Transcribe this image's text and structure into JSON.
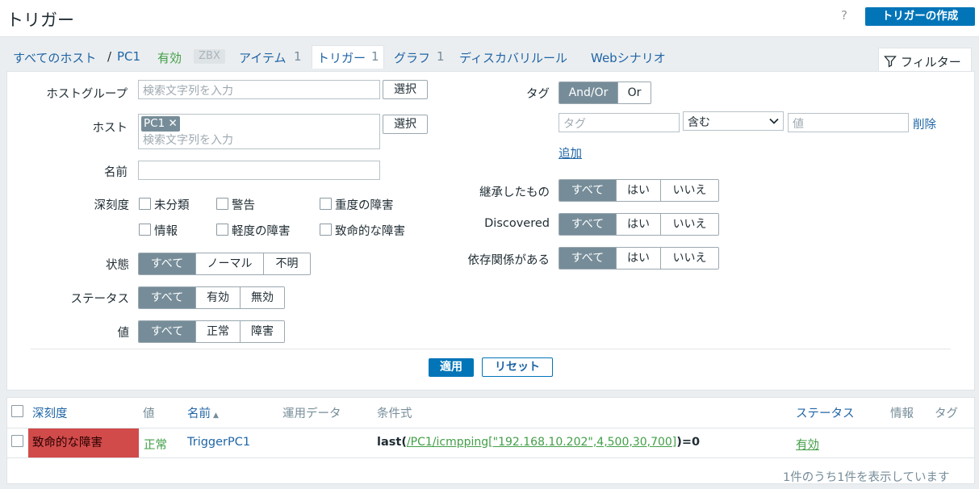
{
  "header": {
    "title": "トリガー",
    "help": "?",
    "create_label": "トリガーの作成"
  },
  "nav": {
    "all_hosts": "すべてのホスト",
    "sep": "/",
    "host": "PC1",
    "status": "有効",
    "zbx": "ZBX",
    "items": "アイテム",
    "items_count": "1",
    "triggers": "トリガー",
    "triggers_count": "1",
    "graphs": "グラフ",
    "graphs_count": "1",
    "discovery": "ディスカバリルール",
    "web": "Webシナリオ",
    "filter_tab": "フィルター"
  },
  "filter": {
    "host_group_label": "ホストグループ",
    "host_group_placeholder": "検索文字列を入力",
    "select_label": "選択",
    "host_label": "ホスト",
    "host_chip": "PC1",
    "host_placeholder": "検索文字列を入力",
    "name_label": "名前",
    "name_value": "",
    "severity_label": "深刻度",
    "severities": [
      "未分類",
      "警告",
      "重度の障害",
      "情報",
      "軽度の障害",
      "致命的な障害"
    ],
    "state_label": "状態",
    "state_options": [
      "すべて",
      "ノーマル",
      "不明"
    ],
    "status_label": "ステータス",
    "status_options": [
      "すべて",
      "有効",
      "無効"
    ],
    "value_label": "値",
    "value_options": [
      "すべて",
      "正常",
      "障害"
    ],
    "tag_label": "タグ",
    "tag_mode": [
      "And/Or",
      "Or"
    ],
    "tag_placeholder": "タグ",
    "tag_operator": "含む",
    "tag_value_placeholder": "値",
    "tag_remove": "削除",
    "tag_add": "追加",
    "inherited_label": "継承したもの",
    "discovered_label": "Discovered",
    "dependencies_label": "依存関係がある",
    "yes_no_options": [
      "すべて",
      "はい",
      "いいえ"
    ],
    "apply_label": "適用",
    "reset_label": "リセット"
  },
  "table": {
    "columns": [
      "深刻度",
      "値",
      "名前",
      "運用データ",
      "条件式",
      "ステータス",
      "情報",
      "タグ"
    ],
    "sort_arrow": "▲",
    "row": {
      "severity": "致命的な障害",
      "value": "正常",
      "name": "TriggerPC1",
      "expr_fn": "last",
      "expr_open": "(",
      "expr_item": "/PC1/icmpping[\"192.168.10.202\",4,500,30,700]",
      "expr_close": ")=0",
      "status": "有効"
    },
    "footer": "1件のうち1件を表示しています"
  }
}
